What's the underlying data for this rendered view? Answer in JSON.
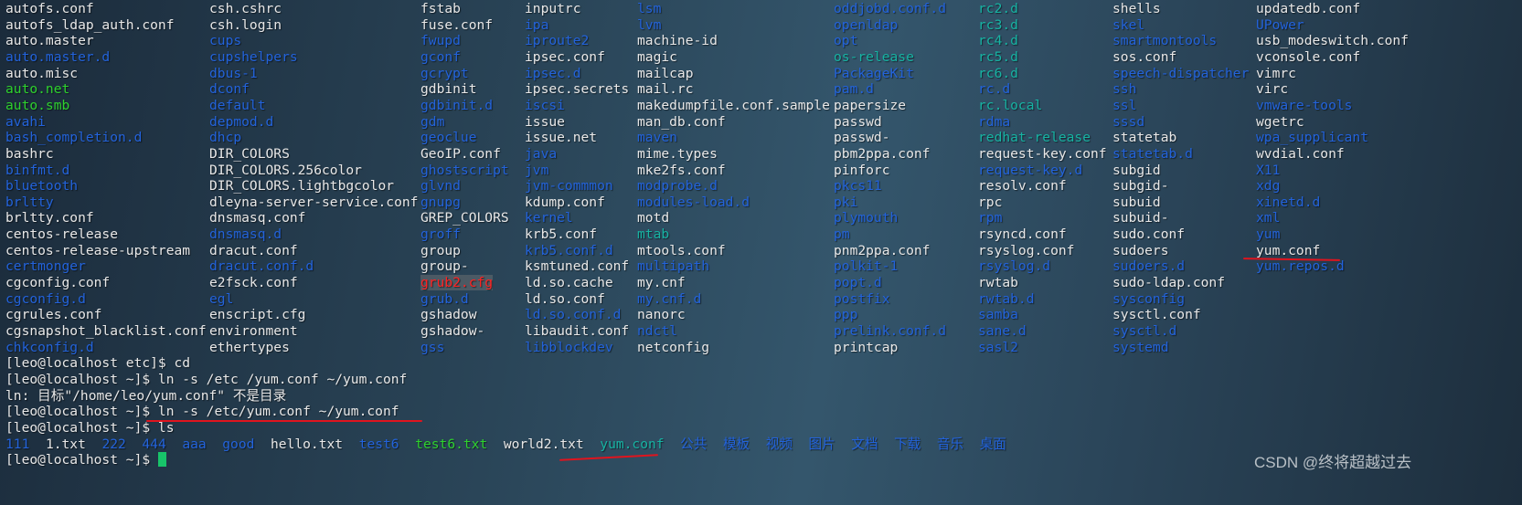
{
  "terminal": {
    "ls_etc_columns": [
      [
        [
          "autofs.conf",
          "f"
        ],
        [
          "autofs_ldap_auth.conf",
          "f"
        ],
        [
          "auto.master",
          "f"
        ],
        [
          "auto.master.d",
          "d"
        ],
        [
          "auto.misc",
          "f"
        ],
        [
          "auto.net",
          "x"
        ],
        [
          "auto.smb",
          "x"
        ],
        [
          "avahi",
          "d"
        ],
        [
          "bash_completion.d",
          "d"
        ],
        [
          "bashrc",
          "f"
        ],
        [
          "binfmt.d",
          "d"
        ],
        [
          "bluetooth",
          "d"
        ],
        [
          "brltty",
          "d"
        ],
        [
          "brltty.conf",
          "f"
        ],
        [
          "centos-release",
          "f"
        ],
        [
          "centos-release-upstream",
          "f"
        ],
        [
          "certmonger",
          "d"
        ],
        [
          "cgconfig.conf",
          "f"
        ],
        [
          "cgconfig.d",
          "d"
        ],
        [
          "cgrules.conf",
          "f"
        ],
        [
          "cgsnapshot_blacklist.conf",
          "f"
        ],
        [
          "chkconfig.d",
          "d"
        ]
      ],
      [
        [
          "csh.cshrc",
          "f"
        ],
        [
          "csh.login",
          "f"
        ],
        [
          "cups",
          "d"
        ],
        [
          "cupshelpers",
          "d"
        ],
        [
          "dbus-1",
          "d"
        ],
        [
          "dconf",
          "d"
        ],
        [
          "default",
          "d"
        ],
        [
          "depmod.d",
          "d"
        ],
        [
          "dhcp",
          "d"
        ],
        [
          "DIR_COLORS",
          "f"
        ],
        [
          "DIR_COLORS.256color",
          "f"
        ],
        [
          "DIR_COLORS.lightbgcolor",
          "f"
        ],
        [
          "dleyna-server-service.conf",
          "f"
        ],
        [
          "dnsmasq.conf",
          "f"
        ],
        [
          "dnsmasq.d",
          "d"
        ],
        [
          "dracut.conf",
          "f"
        ],
        [
          "dracut.conf.d",
          "d"
        ],
        [
          "e2fsck.conf",
          "f"
        ],
        [
          "egl",
          "d"
        ],
        [
          "enscript.cfg",
          "f"
        ],
        [
          "environment",
          "f"
        ],
        [
          "ethertypes",
          "f"
        ]
      ],
      [
        [
          "fstab",
          "f"
        ],
        [
          "fuse.conf",
          "f"
        ],
        [
          "fwupd",
          "d"
        ],
        [
          "gconf",
          "d"
        ],
        [
          "gcrypt",
          "d"
        ],
        [
          "gdbinit",
          "f"
        ],
        [
          "gdbinit.d",
          "d"
        ],
        [
          "gdm",
          "d"
        ],
        [
          "geoclue",
          "d"
        ],
        [
          "GeoIP.conf",
          "f"
        ],
        [
          "ghostscript",
          "d"
        ],
        [
          "glvnd",
          "d"
        ],
        [
          "gnupg",
          "d"
        ],
        [
          "GREP_COLORS",
          "f"
        ],
        [
          "groff",
          "d"
        ],
        [
          "group",
          "f"
        ],
        [
          "group-",
          "f"
        ],
        [
          "grub2.cfg",
          "b"
        ],
        [
          "grub.d",
          "d"
        ],
        [
          "gshadow",
          "f"
        ],
        [
          "gshadow-",
          "f"
        ],
        [
          "gss",
          "d"
        ]
      ],
      [
        [
          "inputrc",
          "f"
        ],
        [
          "ipa",
          "d"
        ],
        [
          "iproute2",
          "d"
        ],
        [
          "ipsec.conf",
          "f"
        ],
        [
          "ipsec.d",
          "d"
        ],
        [
          "ipsec.secrets",
          "f"
        ],
        [
          "iscsi",
          "d"
        ],
        [
          "issue",
          "f"
        ],
        [
          "issue.net",
          "f"
        ],
        [
          "java",
          "d"
        ],
        [
          "jvm",
          "d"
        ],
        [
          "jvm-commmon",
          "d"
        ],
        [
          "kdump.conf",
          "f"
        ],
        [
          "kernel",
          "d"
        ],
        [
          "krb5.conf",
          "f"
        ],
        [
          "krb5.conf.d",
          "d"
        ],
        [
          "ksmtuned.conf",
          "f"
        ],
        [
          "ld.so.cache",
          "f"
        ],
        [
          "ld.so.conf",
          "f"
        ],
        [
          "ld.so.conf.d",
          "d"
        ],
        [
          "libaudit.conf",
          "f"
        ],
        [
          "libblockdev",
          "d"
        ]
      ],
      [
        [
          "lsm",
          "d"
        ],
        [
          "lvm",
          "d"
        ],
        [
          "machine-id",
          "f"
        ],
        [
          "magic",
          "f"
        ],
        [
          "mailcap",
          "f"
        ],
        [
          "mail.rc",
          "f"
        ],
        [
          "makedumpfile.conf.sample",
          "f"
        ],
        [
          "man_db.conf",
          "f"
        ],
        [
          "maven",
          "d"
        ],
        [
          "mime.types",
          "f"
        ],
        [
          "mke2fs.conf",
          "f"
        ],
        [
          "modprobe.d",
          "d"
        ],
        [
          "modules-load.d",
          "d"
        ],
        [
          "motd",
          "f"
        ],
        [
          "mtab",
          "l"
        ],
        [
          "mtools.conf",
          "f"
        ],
        [
          "multipath",
          "d"
        ],
        [
          "my.cnf",
          "f"
        ],
        [
          "my.cnf.d",
          "d"
        ],
        [
          "nanorc",
          "f"
        ],
        [
          "ndctl",
          "d"
        ],
        [
          "netconfig",
          "f"
        ]
      ],
      [
        [
          "oddjobd.conf.d",
          "d"
        ],
        [
          "openldap",
          "d"
        ],
        [
          "opt",
          "d"
        ],
        [
          "os-release",
          "l"
        ],
        [
          "PackageKit",
          "d"
        ],
        [
          "pam.d",
          "d"
        ],
        [
          "papersize",
          "f"
        ],
        [
          "passwd",
          "f"
        ],
        [
          "passwd-",
          "f"
        ],
        [
          "pbm2ppa.conf",
          "f"
        ],
        [
          "pinforc",
          "f"
        ],
        [
          "pkcs11",
          "d"
        ],
        [
          "pki",
          "d"
        ],
        [
          "plymouth",
          "d"
        ],
        [
          "pm",
          "d"
        ],
        [
          "pnm2ppa.conf",
          "f"
        ],
        [
          "polkit-1",
          "d"
        ],
        [
          "popt.d",
          "d"
        ],
        [
          "postfix",
          "d"
        ],
        [
          "ppp",
          "d"
        ],
        [
          "prelink.conf.d",
          "d"
        ],
        [
          "printcap",
          "f"
        ]
      ],
      [
        [
          "rc2.d",
          "l"
        ],
        [
          "rc3.d",
          "l"
        ],
        [
          "rc4.d",
          "l"
        ],
        [
          "rc5.d",
          "l"
        ],
        [
          "rc6.d",
          "l"
        ],
        [
          "rc.d",
          "d"
        ],
        [
          "rc.local",
          "l"
        ],
        [
          "rdma",
          "d"
        ],
        [
          "redhat-release",
          "l"
        ],
        [
          "request-key.conf",
          "f"
        ],
        [
          "request-key.d",
          "d"
        ],
        [
          "resolv.conf",
          "f"
        ],
        [
          "rpc",
          "f"
        ],
        [
          "rpm",
          "d"
        ],
        [
          "rsyncd.conf",
          "f"
        ],
        [
          "rsyslog.conf",
          "f"
        ],
        [
          "rsyslog.d",
          "d"
        ],
        [
          "rwtab",
          "f"
        ],
        [
          "rwtab.d",
          "d"
        ],
        [
          "samba",
          "d"
        ],
        [
          "sane.d",
          "d"
        ],
        [
          "sasl2",
          "d"
        ]
      ],
      [
        [
          "shells",
          "f"
        ],
        [
          "skel",
          "d"
        ],
        [
          "smartmontools",
          "d"
        ],
        [
          "sos.conf",
          "f"
        ],
        [
          "speech-dispatcher",
          "d"
        ],
        [
          "ssh",
          "d"
        ],
        [
          "ssl",
          "d"
        ],
        [
          "sssd",
          "d"
        ],
        [
          "statetab",
          "f"
        ],
        [
          "statetab.d",
          "d"
        ],
        [
          "subgid",
          "f"
        ],
        [
          "subgid-",
          "f"
        ],
        [
          "subuid",
          "f"
        ],
        [
          "subuid-",
          "f"
        ],
        [
          "sudo.conf",
          "f"
        ],
        [
          "sudoers",
          "f"
        ],
        [
          "sudoers.d",
          "d"
        ],
        [
          "sudo-ldap.conf",
          "f"
        ],
        [
          "sysconfig",
          "d"
        ],
        [
          "sysctl.conf",
          "f"
        ],
        [
          "sysctl.d",
          "d"
        ],
        [
          "systemd",
          "d"
        ]
      ],
      [
        [
          "updatedb.conf",
          "f"
        ],
        [
          "UPower",
          "d"
        ],
        [
          "usb_modeswitch.conf",
          "f"
        ],
        [
          "vconsole.conf",
          "f"
        ],
        [
          "vimrc",
          "f"
        ],
        [
          "virc",
          "f"
        ],
        [
          "vmware-tools",
          "d"
        ],
        [
          "wgetrc",
          "f"
        ],
        [
          "wpa_supplicant",
          "d"
        ],
        [
          "wvdial.conf",
          "f"
        ],
        [
          "X11",
          "d"
        ],
        [
          "xdg",
          "d"
        ],
        [
          "xinetd.d",
          "d"
        ],
        [
          "xml",
          "d"
        ],
        [
          "yum",
          "d"
        ],
        [
          "yum.conf",
          "f"
        ],
        [
          "yum.repos.d",
          "d"
        ]
      ]
    ],
    "lines": [
      "[leo@localhost etc]$ cd",
      "[leo@localhost ~]$ ln -s /etc /yum.conf ~/yum.conf",
      "ln: 目标\"/home/leo/yum.conf\" 不是目录",
      "[leo@localhost ~]$ ln -s /etc/yum.conf ~/yum.conf",
      "[leo@localhost ~]$ ls"
    ],
    "ls_home": [
      [
        "111",
        "d"
      ],
      [
        "1.txt",
        "f"
      ],
      [
        "222",
        "d"
      ],
      [
        "444",
        "d"
      ],
      [
        "aaa",
        "d"
      ],
      [
        "good",
        "d"
      ],
      [
        "hello.txt",
        "f"
      ],
      [
        "test6",
        "d"
      ],
      [
        "test6.txt",
        "x"
      ],
      [
        "world2.txt",
        "f"
      ],
      [
        "yum.conf",
        "l"
      ],
      [
        "公共",
        "d"
      ],
      [
        "模板",
        "d"
      ],
      [
        "视频",
        "d"
      ],
      [
        "图片",
        "d"
      ],
      [
        "文档",
        "d"
      ],
      [
        "下载",
        "d"
      ],
      [
        "音乐",
        "d"
      ],
      [
        "桌面",
        "d"
      ]
    ],
    "prompt": "[leo@localhost ~]$ ",
    "colors": {
      "file": "#e8e8e8",
      "directory": "#2363db",
      "executable": "#2ed12e",
      "symlink": "#17b3a3",
      "broken_link": "#ff2222",
      "annotation": "#e0141e",
      "cursor": "#18c46a"
    }
  },
  "watermark": "CSDN @终将超越过去"
}
